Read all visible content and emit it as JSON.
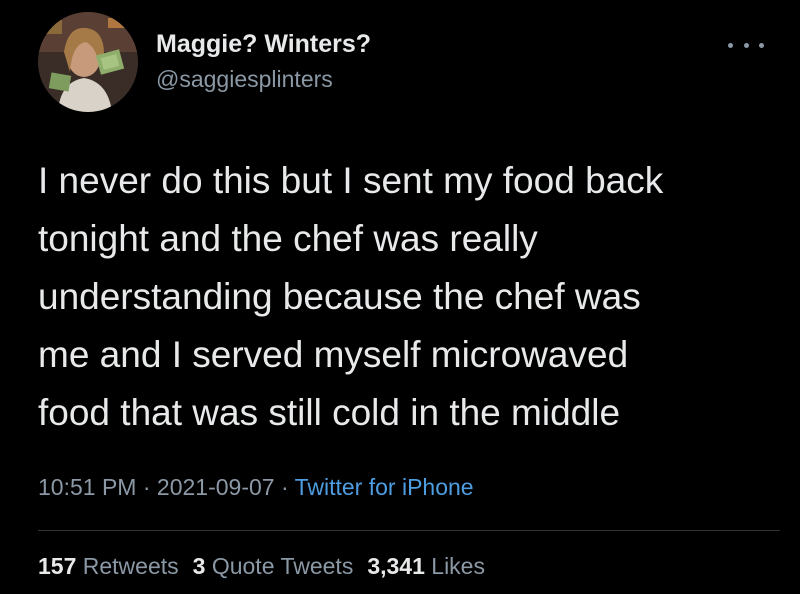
{
  "author": {
    "display_name": "Maggie? Winters?",
    "handle": "@saggiesplinters"
  },
  "tweet": {
    "lines": [
      "I never do this but I sent my food back",
      "tonight and the chef was really",
      "understanding because the chef was",
      "me and I served myself microwaved",
      "food that was still cold in the middle"
    ],
    "time": "10:51 PM",
    "date": "2021-09-07",
    "separator": "·",
    "source": "Twitter for iPhone"
  },
  "stats": {
    "retweets_count": "157",
    "retweets_label": "Retweets",
    "quotes_count": "3",
    "quotes_label": "Quote Tweets",
    "likes_count": "3,341",
    "likes_label": "Likes"
  },
  "icons": {
    "more": "more-horizontal-icon"
  },
  "colors": {
    "background": "#000000",
    "primary_text": "#e7e9ea",
    "secondary_text": "#8b98a5",
    "link": "#4d9de0",
    "divider": "#2f3336"
  }
}
